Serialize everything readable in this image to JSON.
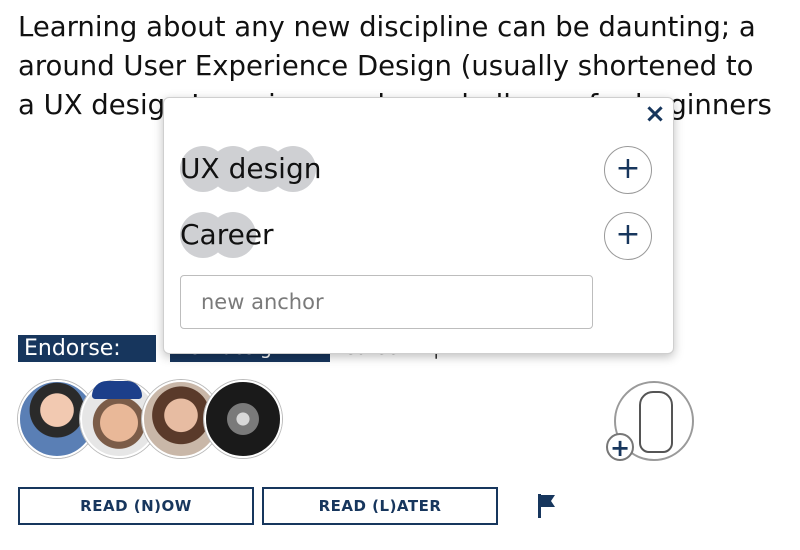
{
  "article": {
    "lines": [
      "Learning about any new discipline can be daunting; a",
      "around User Experience Design (usually shortened to",
      "a UX design Learning can be a challenge for beginners"
    ]
  },
  "endorse": {
    "label": "Endorse:",
    "tags": [
      "UX design",
      "Career"
    ],
    "separator": "|"
  },
  "avatars": [
    "user-avatar-1",
    "user-avatar-2",
    "user-avatar-3",
    "user-avatar-4"
  ],
  "actions": {
    "read_now": "READ (N)OW",
    "read_later": "READ (L)ATER"
  },
  "popover": {
    "close": "×",
    "anchors": [
      {
        "label": "UX design",
        "add": "+"
      },
      {
        "label": "Career",
        "add": "+"
      }
    ],
    "new_anchor_placeholder": "new anchor"
  },
  "icons": {
    "add_endorser": "+",
    "flag": "flag-icon"
  },
  "colors": {
    "brand": "#17365d",
    "bubble": "#cfd0d3"
  }
}
